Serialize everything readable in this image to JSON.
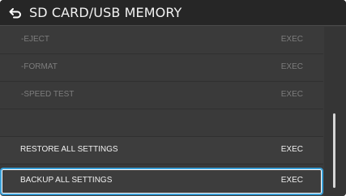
{
  "header": {
    "title": "SD CARD/USB MEMORY",
    "back_icon": "back-arrow-icon"
  },
  "menu": {
    "items": [
      {
        "label": "-EJECT",
        "value": "EXEC",
        "enabled": false
      },
      {
        "label": "-FORMAT",
        "value": "EXEC",
        "enabled": false
      },
      {
        "label": "-SPEED TEST",
        "value": "EXEC",
        "enabled": false
      },
      {
        "label": "",
        "value": "",
        "enabled": false
      },
      {
        "label": "RESTORE ALL SETTINGS",
        "value": "EXEC",
        "enabled": true
      },
      {
        "label": "BACKUP ALL SETTINGS",
        "value": "EXEC",
        "enabled": true,
        "selected": true
      }
    ]
  },
  "colors": {
    "highlight": "#3aa0d8",
    "disabled_text": "#7d7d7d",
    "text": "#f0f0f0",
    "header_bg": "#262626"
  }
}
